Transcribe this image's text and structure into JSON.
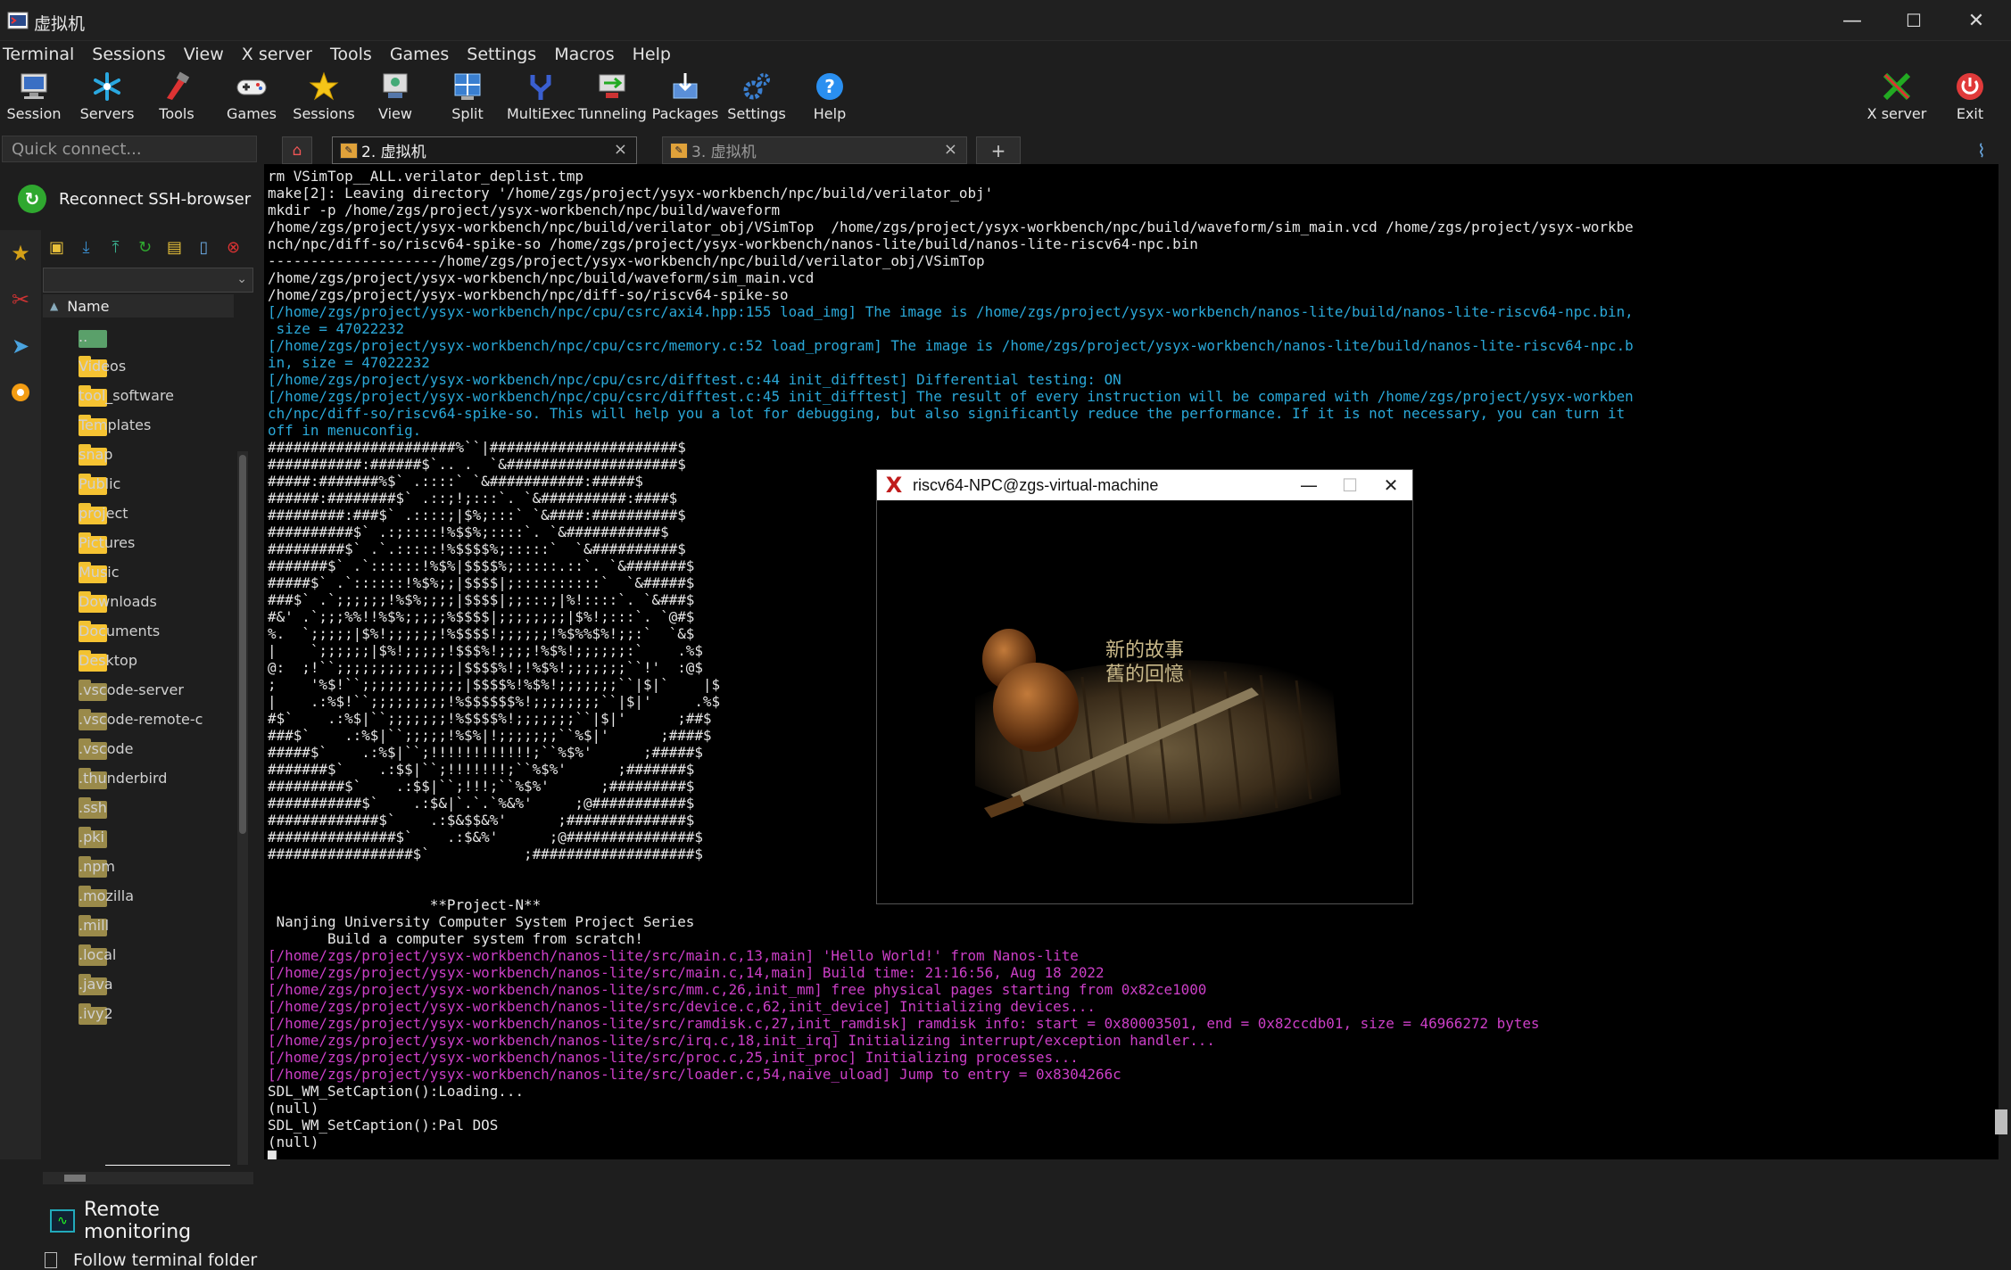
{
  "window": {
    "title": "虚拟机",
    "minimize": "—",
    "maximize": "☐",
    "close": "✕"
  },
  "menu": [
    "Terminal",
    "Sessions",
    "View",
    "X server",
    "Tools",
    "Games",
    "Settings",
    "Macros",
    "Help"
  ],
  "toolbar": [
    {
      "label": "Session",
      "icon": "session-icon"
    },
    {
      "label": "Servers",
      "icon": "servers-icon"
    },
    {
      "label": "Tools",
      "icon": "tools-icon"
    },
    {
      "label": "Games",
      "icon": "gamepad-icon"
    },
    {
      "label": "Sessions",
      "icon": "star-icon"
    },
    {
      "label": "View",
      "icon": "view-icon"
    },
    {
      "label": "Split",
      "icon": "split-icon"
    },
    {
      "label": "MultiExec",
      "icon": "multiexec-icon"
    },
    {
      "label": "Tunneling",
      "icon": "tunneling-icon"
    },
    {
      "label": "Packages",
      "icon": "packages-icon"
    },
    {
      "label": "Settings",
      "icon": "settings-icon"
    },
    {
      "label": "Help",
      "icon": "help-icon"
    }
  ],
  "toolbar_right": [
    {
      "label": "X server",
      "icon": "xserver-icon"
    },
    {
      "label": "Exit",
      "icon": "power-icon"
    }
  ],
  "left": {
    "quick_connect_placeholder": "Quick connect...",
    "reconnect_label": "Reconnect SSH-browser",
    "name_header": "Name",
    "files": [
      "..",
      "Videos",
      "tool_software",
      "Templates",
      "snap",
      "Public",
      "project",
      "Pictures",
      "Music",
      "Downloads",
      "Documents",
      "Desktop",
      ".vscode-server",
      ".vscode-remote-containers",
      ".vscode",
      ".thunderbird",
      ".ssh",
      ".pki",
      ".npm",
      ".mozilla",
      ".mill",
      ".local",
      ".java",
      ".ivy2"
    ],
    "remote_monitoring": "Remote monitoring",
    "follow_terminal": "Follow terminal folder"
  },
  "tabs": [
    {
      "label": "2. 虚拟机",
      "close": "×"
    },
    {
      "label": "3. 虚拟机",
      "close": "×"
    }
  ],
  "tab_add": "+",
  "terminal_lines": [
    {
      "t": "rm VSimTop__ALL.verilator_deplist.tmp",
      "c": ""
    },
    {
      "t": "make[2]: Leaving directory '/home/zgs/project/ysyx-workbench/npc/build/verilator_obj'",
      "c": ""
    },
    {
      "t": "mkdir -p /home/zgs/project/ysyx-workbench/npc/build/waveform",
      "c": ""
    },
    {
      "t": "/home/zgs/project/ysyx-workbench/npc/build/verilator_obj/VSimTop  /home/zgs/project/ysyx-workbench/npc/build/waveform/sim_main.vcd /home/zgs/project/ysyx-workbe",
      "c": ""
    },
    {
      "t": "nch/npc/diff-so/riscv64-spike-so /home/zgs/project/ysyx-workbench/nanos-lite/build/nanos-lite-riscv64-npc.bin",
      "c": ""
    },
    {
      "t": "--------------------/home/zgs/project/ysyx-workbench/npc/build/verilator_obj/VSimTop",
      "c": ""
    },
    {
      "t": "/home/zgs/project/ysyx-workbench/npc/build/waveform/sim_main.vcd",
      "c": ""
    },
    {
      "t": "/home/zgs/project/ysyx-workbench/npc/diff-so/riscv64-spike-so",
      "c": ""
    },
    {
      "t": "[/home/zgs/project/ysyx-workbench/npc/cpu/csrc/axi4.hpp:155 load_img] The image is /home/zgs/project/ysyx-workbench/nanos-lite/build/nanos-lite-riscv64-npc.bin,",
      "c": "cyan"
    },
    {
      "t": " size = 47022232",
      "c": "cyan"
    },
    {
      "t": "[/home/zgs/project/ysyx-workbench/npc/cpu/csrc/memory.c:52 load_program] The image is /home/zgs/project/ysyx-workbench/nanos-lite/build/nanos-lite-riscv64-npc.b",
      "c": "cyan"
    },
    {
      "t": "in, size = 47022232",
      "c": "cyan"
    },
    {
      "t": "[/home/zgs/project/ysyx-workbench/npc/cpu/csrc/difftest.c:44 init_difftest] Differential testing: ON",
      "c": "cyan"
    },
    {
      "t": "[/home/zgs/project/ysyx-workbench/npc/cpu/csrc/difftest.c:45 init_difftest] The result of every instruction will be compared with /home/zgs/project/ysyx-workben",
      "c": "cyan"
    },
    {
      "t": "ch/npc/diff-so/riscv64-spike-so. This will help you a lot for debugging, but also significantly reduce the performance. If it is not necessary, you can turn it",
      "c": "cyan"
    },
    {
      "t": "off in menuconfig.",
      "c": "cyan"
    },
    {
      "t": "######################%``|######################$",
      "c": ""
    },
    {
      "t": "###########:######$`.. .  `&####################$",
      "c": ""
    },
    {
      "t": "#####:#######%$` .::::` `&###########:#####$",
      "c": ""
    },
    {
      "t": "######:########$` .::;!;:::`. `&##########:####$",
      "c": ""
    },
    {
      "t": "#########:###$` .::::;|$%;:::` `&####:##########$",
      "c": ""
    },
    {
      "t": "##########$` .:;::::!%$$%;::::`. `&###########$",
      "c": ""
    },
    {
      "t": "#########$` .`.:::::!%$$$$%;:::::`  `&##########$",
      "c": ""
    },
    {
      "t": "#######$` .`::::::!%$%|$$$$%;:::::.::`. `&#######$",
      "c": ""
    },
    {
      "t": "#####$` .`::::::!%$%;;|$$$$|;::::::::::`  `&#####$",
      "c": ""
    },
    {
      "t": "###$` .`;;;;;;!%$%;;;;|$$$$|;;:::;|%!::::`. `&###$",
      "c": ""
    },
    {
      "t": "#&' .`;;;%%!!%$%;;;;;%$$$$|;;;;;;;;|$%!;:::`. `@#$",
      "c": ""
    },
    {
      "t": "%.  `;;;;;|$%!;;;;;;!%$$$$!;;;;;;!%$%%$%!;;:`  `&$",
      "c": ""
    },
    {
      "t": "|    `;;;;;;|$%!;;;;;!$$$%!;;;;!%$%!;;;;;;:`    .%$",
      "c": ""
    },
    {
      "t": "@:  ;!``;;;;;;;;;;;;;;|$$$$%!;!%$%!;;;;;;;``!'  :@$",
      "c": ""
    },
    {
      "t": ";    '%$!``;;;;;;;;;;;;|$$$$%!%$%!;;;;;;;``|$|`    |$",
      "c": ""
    },
    {
      "t": "|    .:%$!``;;;;;;;;;!%$$$$$$%!;;;;;;;;``|$|'     .%$",
      "c": ""
    },
    {
      "t": "#$`    .:%$|``;;;;;;;!%$$$$%!;;;;;;;``|$|'      ;##$",
      "c": ""
    },
    {
      "t": "###$`    .:%$|``;;;;;!%$%|!;;;;;;;``%$|'      ;####$",
      "c": ""
    },
    {
      "t": "#####$`    .:%$|``;!!!!!!!!!!!!;``%$%'      ;#####$",
      "c": ""
    },
    {
      "t": "#######$`    .:$$|``;!!!!!!!;``%$%'      ;#######$",
      "c": ""
    },
    {
      "t": "#########$`    .:$$|``;!!!;``%$%'      ;#########$",
      "c": ""
    },
    {
      "t": "###########$`    .:$&|`.`.`%&%'     ;@###########$",
      "c": ""
    },
    {
      "t": "#############$`    .:$&$$&%'      ;##############$",
      "c": ""
    },
    {
      "t": "###############$`    .:$&%'      ;@###############$",
      "c": ""
    },
    {
      "t": "#################$`           ;###################$",
      "c": ""
    },
    {
      "t": "",
      "c": ""
    },
    {
      "t": "",
      "c": ""
    },
    {
      "t": "                   **Project-N**",
      "c": ""
    },
    {
      "t": " Nanjing University Computer System Project Series",
      "c": ""
    },
    {
      "t": "       Build a computer system from scratch!",
      "c": ""
    },
    {
      "t": "[/home/zgs/project/ysyx-workbench/nanos-lite/src/main.c,13,main] 'Hello World!' from Nanos-lite",
      "c": "pink"
    },
    {
      "t": "[/home/zgs/project/ysyx-workbench/nanos-lite/src/main.c,14,main] Build time: 21:16:56, Aug 18 2022",
      "c": "pink"
    },
    {
      "t": "[/home/zgs/project/ysyx-workbench/nanos-lite/src/mm.c,26,init_mm] free physical pages starting from 0x82ce1000",
      "c": "pink"
    },
    {
      "t": "[/home/zgs/project/ysyx-workbench/nanos-lite/src/device.c,62,init_device] Initializing devices...",
      "c": "pink"
    },
    {
      "t": "[/home/zgs/project/ysyx-workbench/nanos-lite/src/ramdisk.c,27,init_ramdisk] ramdisk info: start = 0x80003501, end = 0x82ccdb01, size = 46966272 bytes",
      "c": "pink"
    },
    {
      "t": "[/home/zgs/project/ysyx-workbench/nanos-lite/src/irq.c,18,init_irq] Initializing interrupt/exception handler...",
      "c": "pink"
    },
    {
      "t": "[/home/zgs/project/ysyx-workbench/nanos-lite/src/proc.c,25,init_proc] Initializing processes...",
      "c": "pink"
    },
    {
      "t": "[/home/zgs/project/ysyx-workbench/nanos-lite/src/loader.c,54,naive_uload] Jump to entry = 0x8304266c",
      "c": "pink"
    },
    {
      "t": "SDL_WM_SetCaption():Loading...",
      "c": ""
    },
    {
      "t": "(null)",
      "c": ""
    },
    {
      "t": "SDL_WM_SetCaption():Pal DOS",
      "c": ""
    },
    {
      "t": "(null)",
      "c": ""
    },
    {
      "t": "█",
      "c": ""
    }
  ],
  "sdl_window": {
    "title": "riscv64-NPC@zgs-virtual-machine",
    "minimize": "—",
    "maximize": "☐",
    "close": "✕",
    "text_line1": "新的故事",
    "text_line2": "舊的回憶"
  },
  "colors": {
    "cyan": "#2aa8d8",
    "pink": "#cc3fc7",
    "accent_green": "#2fa82f",
    "folder": "#f6c332"
  }
}
